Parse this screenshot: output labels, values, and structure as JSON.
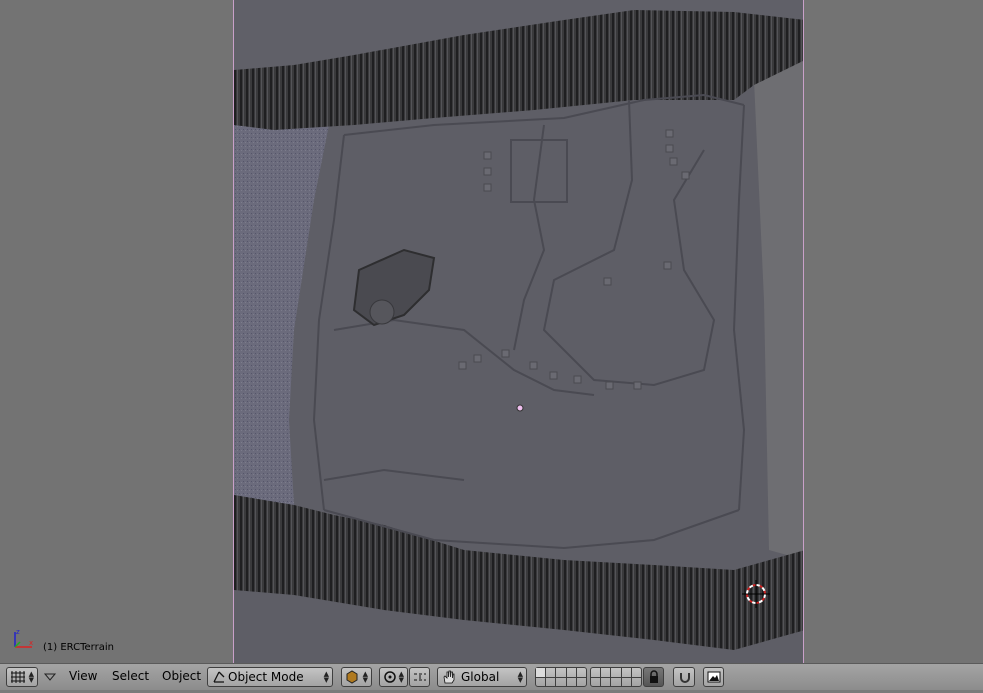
{
  "viewport": {
    "object_label": "(1) ERCTerrain"
  },
  "header": {
    "editor_type_icon": "grid-icon",
    "menus": [
      "View",
      "Select",
      "Object"
    ],
    "mode": "Object Mode",
    "orientation": "Global",
    "icons": {
      "draw_type": "solid-shading-icon",
      "pivot": "pivot-icon",
      "align": "align-icon",
      "manipulator": "hand-icon",
      "lock": "lock-icon",
      "snap": "magnet-icon",
      "render": "render-icon"
    }
  },
  "colors": {
    "viewport_bg": "#737373",
    "terrain": "#5e5e66",
    "cliff": "#2e2e30",
    "water": "#6a6a7a",
    "camera_border": "#c9a0c9",
    "cursor_red": "#cc2222"
  }
}
